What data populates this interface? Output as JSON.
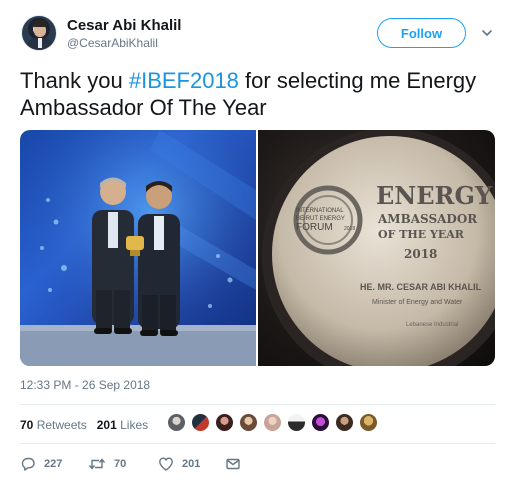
{
  "user": {
    "name": "Cesar Abi Khalil",
    "handle": "@CesarAbiKhalil",
    "follow_label": "Follow"
  },
  "tweet": {
    "text_before": "Thank you ",
    "hashtag": "#IBEF2018",
    "text_after": " for selecting me Energy Ambassador Of The Year",
    "timestamp": "12:33 PM - 26 Sep 2018"
  },
  "award": {
    "logo_line1": "INTERNATIONAL",
    "logo_line2": "BEIRUT ENERGY",
    "logo_line3": "FORUM",
    "logo_year": "2018",
    "title_line1": "ENERGY",
    "title_line2": "AMBASSADOR",
    "title_line3": "OF THE YEAR",
    "year": "2018",
    "recipient": "HE. MR. CESAR ABI KHALIL",
    "role": "Minister of Energy and Water",
    "footer": "Lebanese Industrial"
  },
  "stats": {
    "retweets_count": "70",
    "retweets_label": "Retweets",
    "likes_count": "201",
    "likes_label": "Likes"
  },
  "actions": {
    "replies": "227",
    "retweets": "70",
    "likes": "201"
  },
  "colors": {
    "accent": "#1da1f2",
    "hashtag": "#1b95e0",
    "muted": "#657786"
  }
}
